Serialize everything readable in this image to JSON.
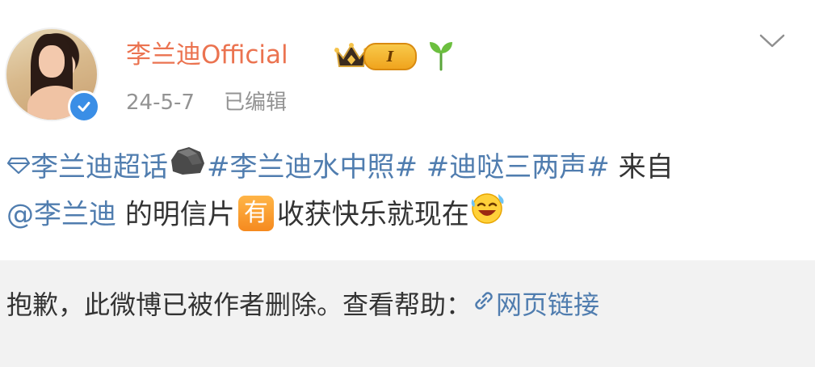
{
  "post": {
    "author": "李兰迪Official",
    "level": "I",
    "date": "24-5-7",
    "edited_label": "已编辑",
    "super_topic": "李兰迪超话",
    "hashtag1": "#李兰迪水中照#",
    "hashtag2": "#迪哒三两声#",
    "text_from": "来自",
    "mention": "@李兰迪",
    "text_postcard": "的明信片",
    "you_badge": "有",
    "text_tail": "收获快乐就现在",
    "icons": {
      "avatar": "avatar-photo",
      "verified": "verified-badge-icon",
      "crown": "crown-icon",
      "sprout": "sprout-icon",
      "chevron": "chevron-down-icon",
      "supertopic": "diamond-icon",
      "rock": "rock-icon",
      "emoji": "laughing-tears-emoji-icon",
      "link": "link-icon"
    }
  },
  "notice": {
    "deleted_text": "抱歉，此微博已被作者删除。查看帮助：",
    "help_link": "网页链接"
  },
  "colors": {
    "author": "#eb7350",
    "link": "#507daf",
    "meta": "#939393",
    "footer_bg": "#f2f2f2"
  }
}
